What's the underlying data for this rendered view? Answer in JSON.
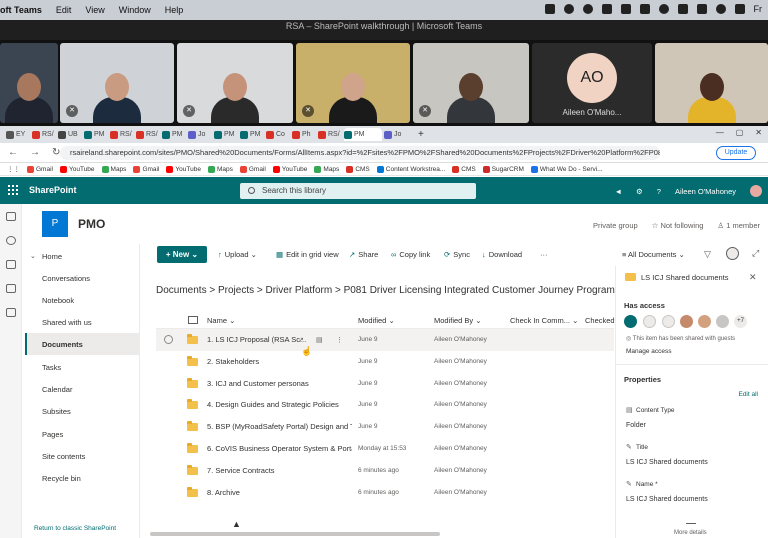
{
  "mac_menubar": {
    "app_name": "oft Teams",
    "menus": [
      "Edit",
      "View",
      "Window",
      "Help"
    ],
    "clock": "Fr"
  },
  "teams": {
    "window_title": "RSA – SharePoint walkthrough | Microsoft Teams",
    "participant_avatar": "AO",
    "participant_name": "Aileen O'Maho..."
  },
  "browser": {
    "tabs": [
      {
        "label": "EY",
        "color": "#555555"
      },
      {
        "label": "RS/",
        "color": "#d93025"
      },
      {
        "label": "UB",
        "color": "#444444"
      },
      {
        "label": "PM",
        "color": "#036c70"
      },
      {
        "label": "RS/",
        "color": "#d93025"
      },
      {
        "label": "RS/",
        "color": "#d93025"
      },
      {
        "label": "PM",
        "color": "#036c70"
      },
      {
        "label": "Jo",
        "color": "#5b5fc7"
      },
      {
        "label": "PM",
        "color": "#036c70"
      },
      {
        "label": "PM",
        "color": "#036c70"
      },
      {
        "label": "Co",
        "color": "#d93025"
      },
      {
        "label": "Ph",
        "color": "#d93025"
      },
      {
        "label": "RS/",
        "color": "#d93025"
      },
      {
        "label": "PM",
        "color": "#036c70"
      },
      {
        "label": "Jo",
        "color": "#5b5fc7"
      }
    ],
    "new_tab": "+",
    "url": "rsaireland.sharepoint.com/sites/PMO/Shared%20Documents/Forms/AllItems.aspx?id=%2Fsites%2FPMO%2FShared%20Documents%2FProjects%2FDriver%20Platform%2FP081%20Driver...",
    "update_label": "Update",
    "bookmarks": [
      {
        "label": "Gmail",
        "color": "#ea4335"
      },
      {
        "label": "YouTube",
        "color": "#ff0000"
      },
      {
        "label": "Maps",
        "color": "#34a853"
      },
      {
        "label": "Gmail",
        "color": "#ea4335"
      },
      {
        "label": "YouTube",
        "color": "#ff0000"
      },
      {
        "label": "Maps",
        "color": "#34a853"
      },
      {
        "label": "Gmail",
        "color": "#ea4335"
      },
      {
        "label": "YouTube",
        "color": "#ff0000"
      },
      {
        "label": "Maps",
        "color": "#34a853"
      },
      {
        "label": "CMS",
        "color": "#d93025"
      },
      {
        "label": "Content Workstrea...",
        "color": "#0078d4"
      },
      {
        "label": "CMS",
        "color": "#d93025"
      },
      {
        "label": "SugarCRM",
        "color": "#cc2b2b"
      },
      {
        "label": "What We Do - Servi...",
        "color": "#1a73e8"
      }
    ]
  },
  "sharepoint": {
    "brand": "SharePoint",
    "search_placeholder": "Search this library",
    "user_name": "Aileen O'Mahoney",
    "site_logo_letter": "P",
    "site_name": "PMO",
    "site_privacy": "Private group",
    "follow_label": "Not following",
    "members_label": "1 member",
    "nav": [
      "Home",
      "Conversations",
      "Notebook",
      "Shared with us",
      "Documents",
      "Tasks",
      "Calendar",
      "Subsites",
      "Pages",
      "Site contents",
      "Recycle bin"
    ],
    "return_classic": "Return to classic SharePoint",
    "commands": {
      "new": "New",
      "upload": "Upload",
      "grid": "Edit in grid view",
      "share": "Share",
      "copy_link": "Copy link",
      "sync": "Sync",
      "download": "Download",
      "more": "···",
      "view": "All Documents"
    },
    "breadcrumb": "Documents  >  Projects  >  Driver Platform  >  P081 Driver Licensing Integrated Customer Journey Programme  >  LS",
    "columns": [
      "Name",
      "Modified",
      "Modified By",
      "Check In Comm...",
      "Checked"
    ],
    "files": [
      {
        "name": "1. LS ICJ Proposal (RSA Sc...",
        "modified": "June 9",
        "by": "Aileen O'Mahoney"
      },
      {
        "name": "2. Stakeholders",
        "modified": "June 9",
        "by": "Aileen O'Mahoney"
      },
      {
        "name": "3. ICJ and Customer personas",
        "modified": "June 9",
        "by": "Aileen O'Mahoney"
      },
      {
        "name": "4. Design Guides and Strategic Policies",
        "modified": "June 9",
        "by": "Aileen O'Mahoney"
      },
      {
        "name": "5. BSP (MyRoadSafety Portal) Design and Te...",
        "modified": "June 9",
        "by": "Aileen O'Mahoney"
      },
      {
        "name": "6. CoVIS Business Operator System & Portal...",
        "modified": "Monday at 15:53",
        "by": "Aileen O'Mahoney"
      },
      {
        "name": "7. Service Contracts",
        "modified": "6 minutes ago",
        "by": "Aileen O'Mahoney"
      },
      {
        "name": "8. Archive",
        "modified": "6 minutes ago",
        "by": "Aileen O'Mahoney"
      }
    ],
    "panel": {
      "title": "LS ICJ Shared documents",
      "has_access": "Has access",
      "more_count": "+7",
      "shared_note": "This item has been shared with guests",
      "manage_access": "Manage access",
      "properties": "Properties",
      "edit_all": "Edit all",
      "content_type_label": "Content Type",
      "content_type_value": "Folder",
      "title_label": "Title",
      "title_value": "LS ICJ Shared documents",
      "name_label": "Name *",
      "name_value": "LS ICJ Shared documents",
      "more_details": "More details"
    }
  }
}
